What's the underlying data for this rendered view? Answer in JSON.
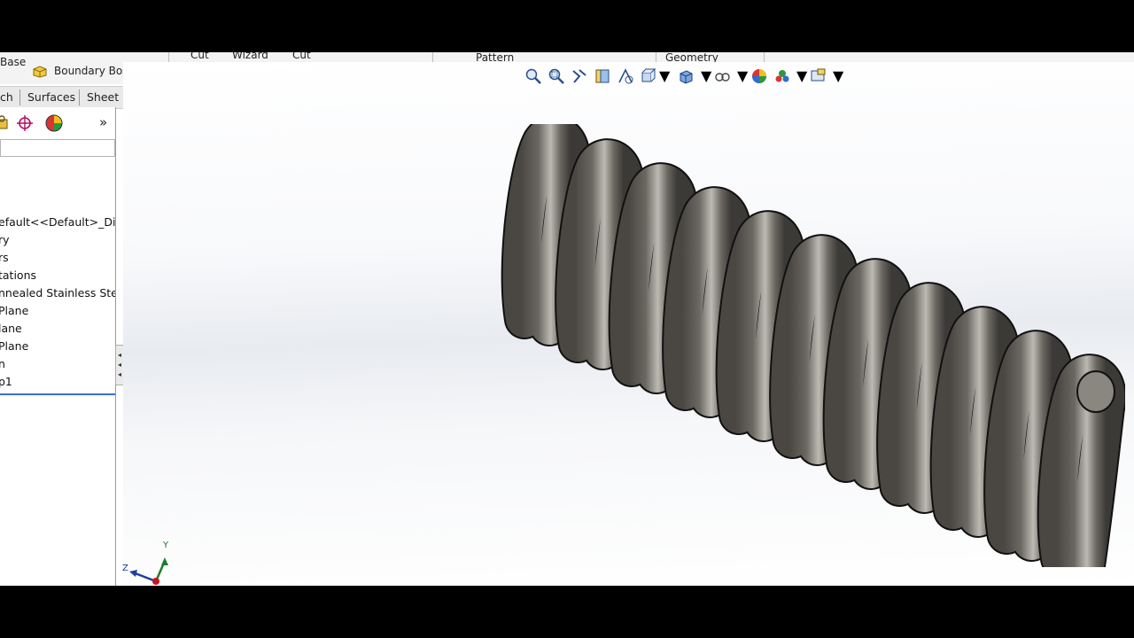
{
  "ribbon": {
    "partial_labels": [
      "Cut",
      "Wizard",
      "Cut",
      "Pattern",
      "Geometry"
    ]
  },
  "command_manager": {
    "items": [
      {
        "label": "Base",
        "icon": "extruded-boss-icon"
      },
      {
        "label": "Boundary Boss",
        "icon": "boundary-boss-icon"
      }
    ]
  },
  "tabs": [
    {
      "label": "ch"
    },
    {
      "label": "Surfaces"
    },
    {
      "label": "Sheet Me"
    }
  ],
  "feature_manager": {
    "toolbar_icons": [
      "configuration-manager-icon",
      "dimxpert-icon",
      "display-manager-icon"
    ],
    "expand_glyph": "»",
    "tree": [
      {
        "label": "efault<<Default>_Disp"
      },
      {
        "label": "ry"
      },
      {
        "label": "rs"
      },
      {
        "label": "tations"
      },
      {
        "label": "nnealed Stainless Stee"
      },
      {
        "label": " Plane"
      },
      {
        "label": "lane"
      },
      {
        "label": " Plane"
      },
      {
        "label": "n"
      },
      {
        "label": "p1"
      }
    ]
  },
  "heads_up_toolbar": {
    "icons": [
      "zoom-to-fit-icon",
      "zoom-to-area-icon",
      "previous-view-icon",
      "section-view-icon",
      "dynamic-annotation-icon",
      "view-orientation-icon",
      "display-style-icon",
      "hide-show-items-icon",
      "edit-appearance-icon",
      "apply-scene-icon",
      "view-settings-icon"
    ]
  },
  "triad": {
    "x_label": "",
    "y_label": "Y",
    "z_label": "Z"
  },
  "colors": {
    "spring": "#5a5651",
    "spring_highlight": "#c9c6c1",
    "accent_blue": "#3a6fd4"
  }
}
